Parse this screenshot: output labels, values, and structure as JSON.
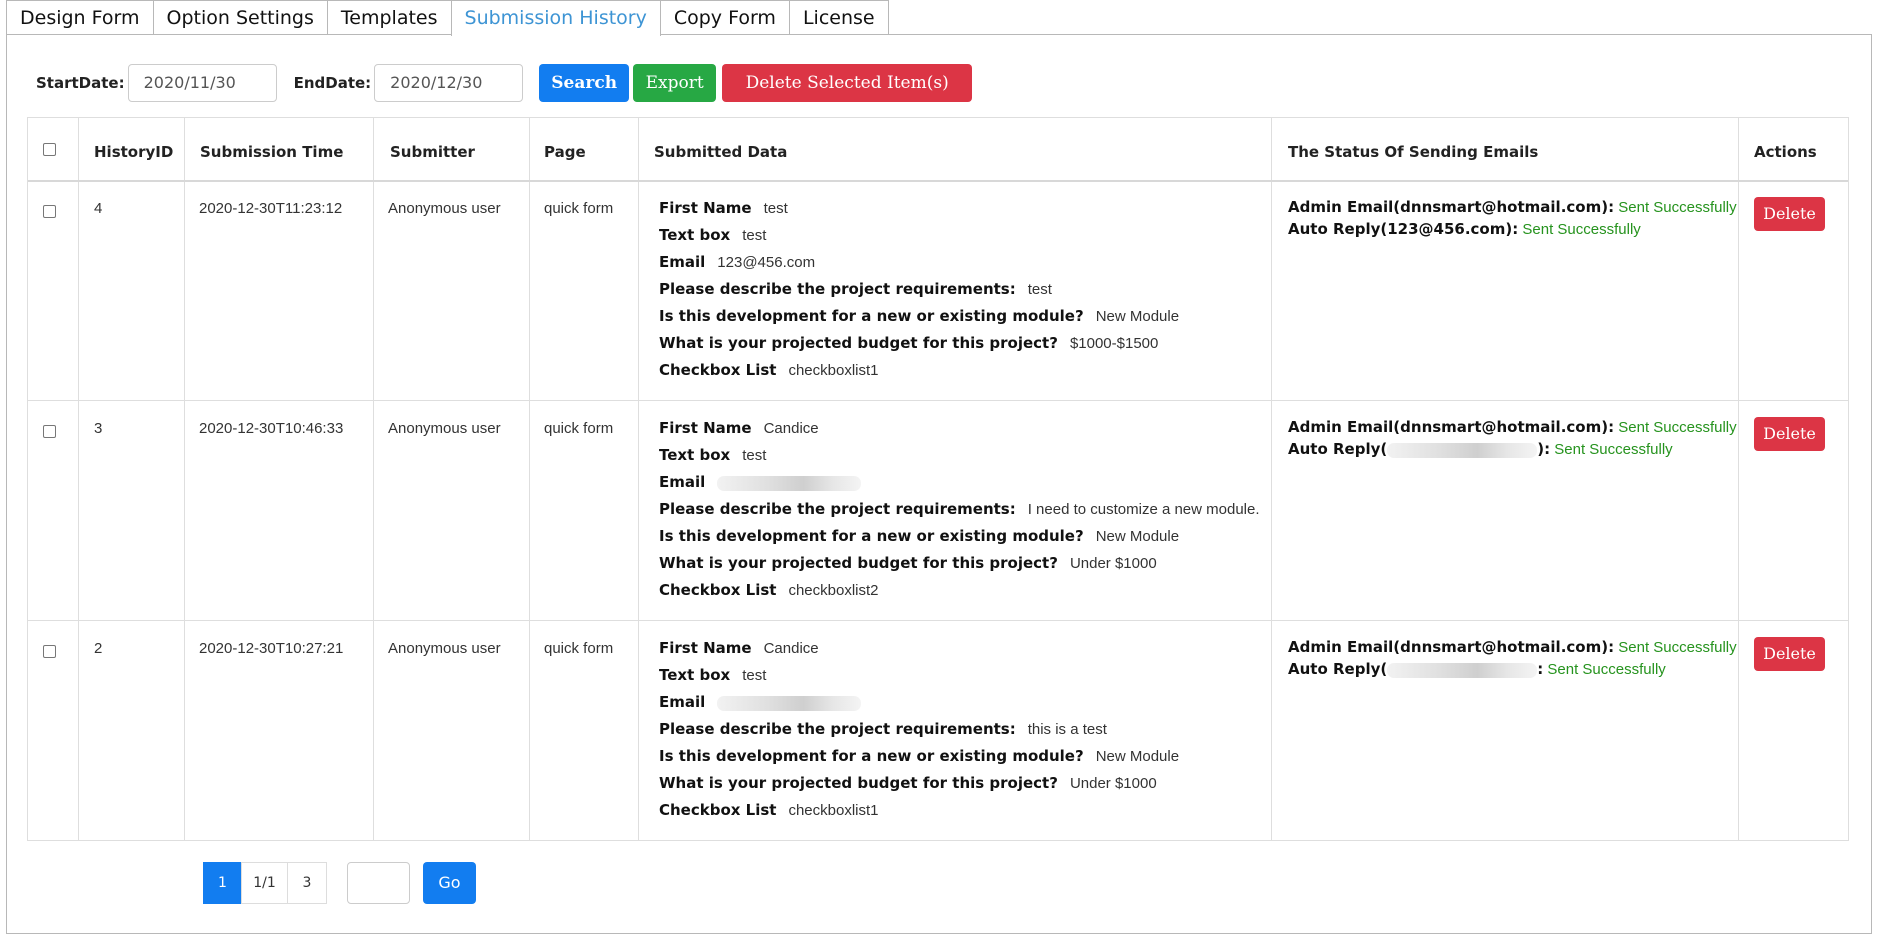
{
  "tabs": [
    {
      "label": "Design Form"
    },
    {
      "label": "Option Settings"
    },
    {
      "label": "Templates"
    },
    {
      "label": "Submission History"
    },
    {
      "label": "Copy Form"
    },
    {
      "label": "License"
    }
  ],
  "active_tab": "Submission History",
  "filters": {
    "start_label": "StartDate:",
    "start_value": "2020/11/30",
    "end_label": "EndDate:",
    "end_value": "2020/12/30"
  },
  "toolbar": {
    "search_label": "Search",
    "export_label": "Export",
    "delete_selected_label": "Delete Selected Item(s)"
  },
  "table": {
    "headers": {
      "history_id": "HistoryID",
      "submission_time": "Submission Time",
      "submitter": "Submitter",
      "page": "Page",
      "submitted_data": "Submitted Data",
      "email_status": "The Status Of Sending Emails",
      "actions": "Actions"
    },
    "rows": [
      {
        "id": "4",
        "time": "2020-12-30T11:23:12",
        "submitter": "Anonymous user",
        "page": "quick form",
        "fields": {
          "first_name": {
            "label": "First Name",
            "value": "test"
          },
          "text_box": {
            "label": "Text box",
            "value": "test"
          },
          "email": {
            "label": "Email",
            "value": "123@456.com"
          },
          "requirements": {
            "label": "Please describe the project requirements:",
            "value": "test"
          },
          "module": {
            "label": "Is this development for a new or existing module?",
            "value": "New Module"
          },
          "budget": {
            "label": "What is your projected budget for this project?",
            "value": "$1000-$1500"
          },
          "checkbox": {
            "label": "Checkbox List",
            "value": "checkboxlist1"
          }
        },
        "emails": {
          "admin_label": "Admin Email(dnnsmart@hotmail.com):",
          "admin_status": "Sent Successfully",
          "reply_label": "Auto Reply(123@456.com):",
          "reply_status": "Sent Successfully"
        },
        "delete_label": "Delete"
      },
      {
        "id": "3",
        "time": "2020-12-30T10:46:33",
        "submitter": "Anonymous user",
        "page": "quick form",
        "fields": {
          "first_name": {
            "label": "First Name",
            "value": "Candice"
          },
          "text_box": {
            "label": "Text box",
            "value": "test"
          },
          "email": {
            "label": "Email",
            "value": ""
          },
          "requirements": {
            "label": "Please describe the project requirements:",
            "value": "I need to customize a new module."
          },
          "module": {
            "label": "Is this development for a new or existing module?",
            "value": "New Module"
          },
          "budget": {
            "label": "What is your projected budget for this project?",
            "value": "Under $1000"
          },
          "checkbox": {
            "label": "Checkbox List",
            "value": "checkboxlist2"
          }
        },
        "emails": {
          "admin_label": "Admin Email(dnnsmart@hotmail.com):",
          "admin_status": "Sent Successfully",
          "reply_prefix": "Auto Reply(",
          "reply_suffix": "):",
          "reply_status": "Sent Successfully"
        },
        "delete_label": "Delete"
      },
      {
        "id": "2",
        "time": "2020-12-30T10:27:21",
        "submitter": "Anonymous user",
        "page": "quick form",
        "fields": {
          "first_name": {
            "label": "First Name",
            "value": "Candice"
          },
          "text_box": {
            "label": "Text box",
            "value": "test"
          },
          "email": {
            "label": "Email",
            "value": ""
          },
          "requirements": {
            "label": "Please describe the project requirements:",
            "value": "this is a test"
          },
          "module": {
            "label": "Is this development for a new or existing module?",
            "value": "New Module"
          },
          "budget": {
            "label": "What is your projected budget for this project?",
            "value": "Under $1000"
          },
          "checkbox": {
            "label": "Checkbox List",
            "value": "checkboxlist1"
          }
        },
        "emails": {
          "admin_label": "Admin Email(dnnsmart@hotmail.com):",
          "admin_status": "Sent Successfully",
          "reply_prefix": "Auto Reply(",
          "reply_suffix": ":",
          "reply_status": "Sent Successfully"
        },
        "delete_label": "Delete"
      }
    ]
  },
  "pagination": {
    "current": "1",
    "info": "1/1",
    "total": "3",
    "go_label": "Go",
    "jump_value": ""
  },
  "colors": {
    "accent_blue": "#127df0",
    "export_green": "#27a844",
    "delete_red": "#dc3545",
    "status_green": "#26931e",
    "active_tab_text": "#3d94d4"
  },
  "icons": [
    "checkbox-icon"
  ]
}
